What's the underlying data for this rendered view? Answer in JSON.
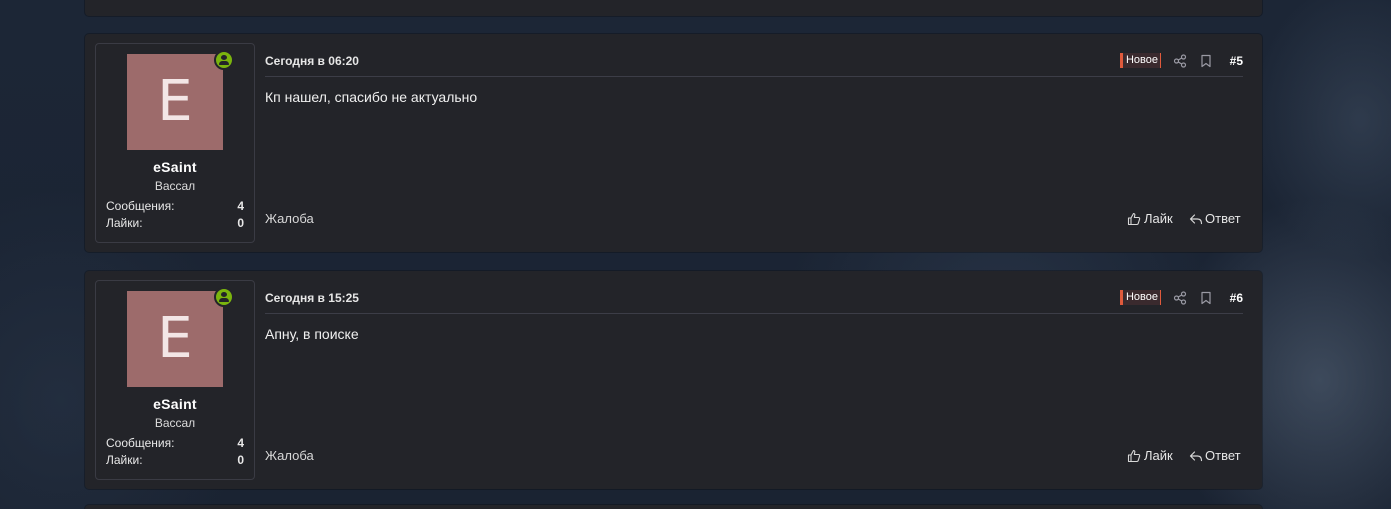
{
  "posts": [
    {
      "avatar_letter": "E",
      "username": "eSaint",
      "user_title": "Вассал",
      "messages_label": "Сообщения:",
      "messages_count": "4",
      "likes_label": "Лайки:",
      "likes_count": "0",
      "date": "Сегодня в 06:20",
      "badge": "Новое",
      "number": "#5",
      "body": "Кп нашел, спасибо не актуально",
      "report_label": "Жалоба",
      "like_label": "Лайк",
      "reply_label": "Ответ"
    },
    {
      "avatar_letter": "E",
      "username": "eSaint",
      "user_title": "Вассал",
      "messages_label": "Сообщения:",
      "messages_count": "4",
      "likes_label": "Лайки:",
      "likes_count": "0",
      "date": "Сегодня в 15:25",
      "badge": "Новое",
      "number": "#6",
      "body": "Апну, в поиске",
      "report_label": "Жалоба",
      "like_label": "Лайк",
      "reply_label": "Ответ"
    }
  ],
  "colors": {
    "avatar": "#9d6b6b",
    "online": "#7bb50e",
    "badge_accent": "#e05a3c",
    "card": "#232429",
    "page_bg": "#1b2434"
  },
  "icons": [
    "online-status-icon",
    "share-icon",
    "bookmark-icon",
    "thumbs-up-icon",
    "reply-icon"
  ]
}
